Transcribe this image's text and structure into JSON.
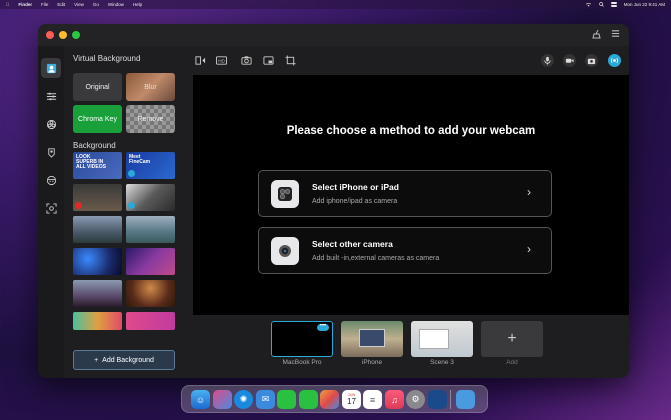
{
  "menubar": {
    "items": [
      "Finder",
      "File",
      "Edit",
      "View",
      "Go",
      "Window",
      "Help"
    ],
    "datetime": "Mon Jun 22  9:41 AM"
  },
  "sidebar": {
    "title": "Virtual Background",
    "options": [
      "Original",
      "Blur",
      "Chroma Key",
      "Remove"
    ],
    "background_label": "Background",
    "promo_text": [
      "LOOK",
      "SUPERB IN",
      "ALL VIDEOS"
    ],
    "promo_text_2": [
      "Meet",
      "FineCam"
    ],
    "add_button": "Add Background"
  },
  "main": {
    "heading": "Please choose a method to add your webcam",
    "methods": [
      {
        "title": "Select iPhone or iPad",
        "subtitle": "Add iphone/ipad as camera",
        "icon": "iphone-camera-icon"
      },
      {
        "title": "Select other camera",
        "subtitle": "Add built -in,external cameras as camera",
        "icon": "webcam-icon"
      }
    ]
  },
  "scenes": [
    {
      "label": "MacBook Pro"
    },
    {
      "label": "iPhone"
    },
    {
      "label": "Scene 3"
    },
    {
      "label": "Add"
    }
  ],
  "colors": {
    "accent": "#2aa8d8",
    "chroma": "#1aa03a",
    "preview_bg": "#000000"
  },
  "dock": {
    "calendar_month": "JUN",
    "calendar_day": "17"
  }
}
